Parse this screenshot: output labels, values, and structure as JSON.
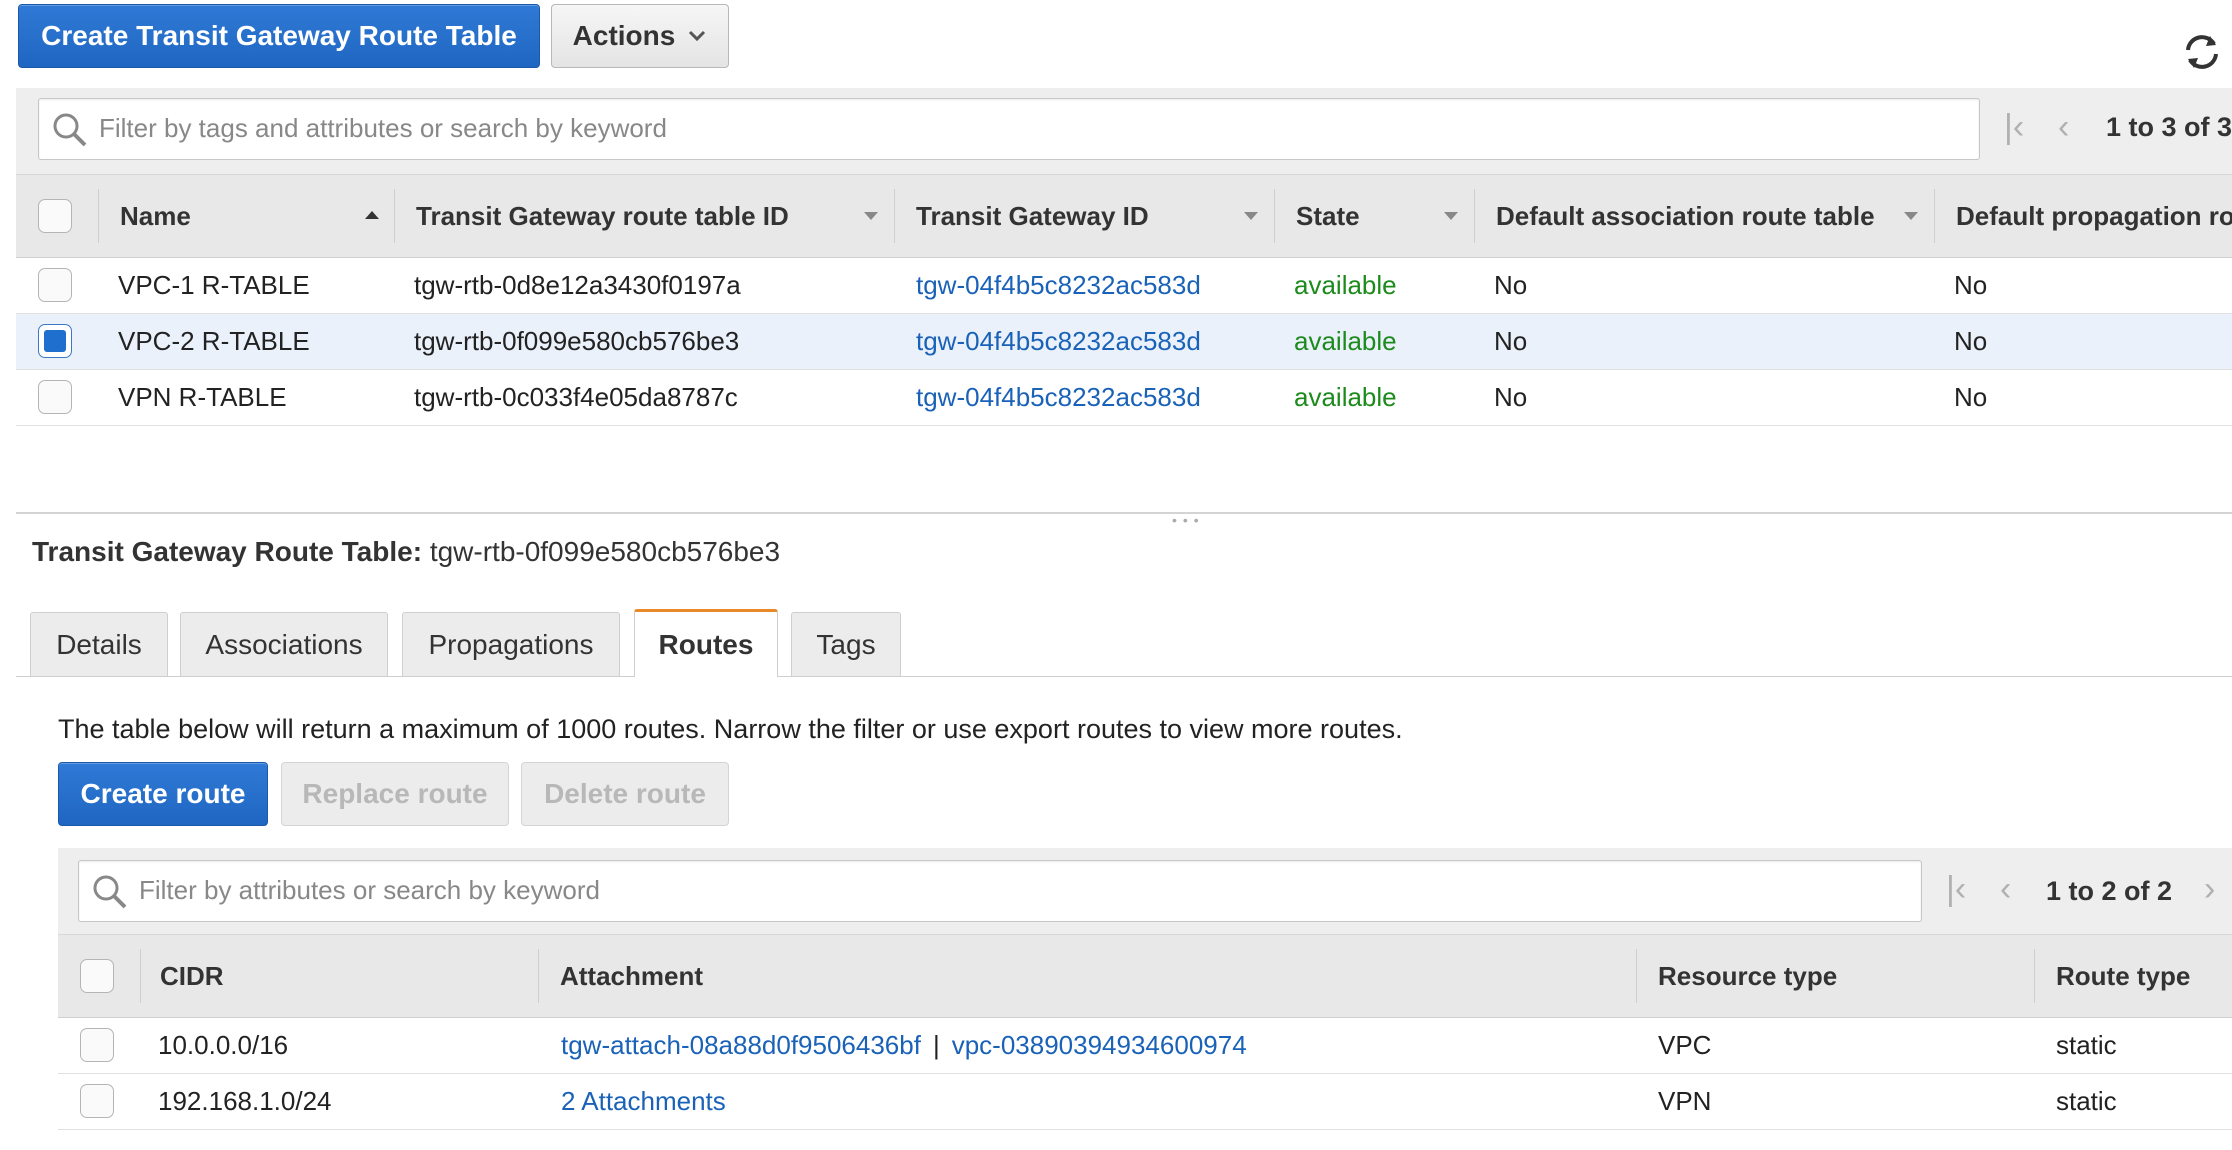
{
  "toolbar": {
    "create_label": "Create Transit Gateway Route Table",
    "actions_label": "Actions",
    "refresh_icon": "refresh-icon"
  },
  "top_search": {
    "placeholder": "Filter by tags and attributes or search by keyword",
    "pagination": "1 to 3 of 3"
  },
  "route_tables": {
    "columns": [
      "Name",
      "Transit Gateway route table ID",
      "Transit Gateway ID",
      "State",
      "Default association route table",
      "Default propagation ro"
    ],
    "rows": [
      {
        "name": "VPC-1 R-TABLE",
        "id": "tgw-rtb-0d8e12a3430f0197a",
        "tgw": "tgw-04f4b5c8232ac583d",
        "state": "available",
        "assoc": "No",
        "prop": "No",
        "selected": false
      },
      {
        "name": "VPC-2 R-TABLE",
        "id": "tgw-rtb-0f099e580cb576be3",
        "tgw": "tgw-04f4b5c8232ac583d",
        "state": "available",
        "assoc": "No",
        "prop": "No",
        "selected": true
      },
      {
        "name": "VPN R-TABLE",
        "id": "tgw-rtb-0c033f4e05da8787c",
        "tgw": "tgw-04f4b5c8232ac583d",
        "state": "available",
        "assoc": "No",
        "prop": "No",
        "selected": false
      }
    ]
  },
  "detail": {
    "title_label": "Transit Gateway Route Table:",
    "title_value": "tgw-rtb-0f099e580cb576be3",
    "resize_handle": "•••",
    "tabs": [
      "Details",
      "Associations",
      "Propagations",
      "Routes",
      "Tags"
    ],
    "active_tab": "Routes",
    "notice": "The table below will return a maximum of 1000 routes. Narrow the filter or use export routes to view more routes."
  },
  "routes_toolbar": {
    "create_label": "Create route",
    "replace_label": "Replace route",
    "delete_label": "Delete route"
  },
  "routes_search": {
    "placeholder": "Filter by attributes or search by keyword",
    "pagination": "1 to 2 of 2"
  },
  "routes": {
    "columns": [
      "CIDR",
      "Attachment",
      "Resource type",
      "Route type"
    ],
    "rows": [
      {
        "cidr": "10.0.0.0/16",
        "attachment": "tgw-attach-08a88d0f9506436bf",
        "sep": "|",
        "attachment_vpc": "vpc-03890394934600974",
        "resource": "VPC",
        "type": "static"
      },
      {
        "cidr": "192.168.1.0/24",
        "attachment": "2 Attachments",
        "resource": "VPN",
        "type": "static"
      }
    ]
  },
  "colors": {
    "primary": "#1f66c2",
    "link": "#1a62b8",
    "available": "#1d8a1d",
    "active_tab_accent": "#e8892b"
  }
}
